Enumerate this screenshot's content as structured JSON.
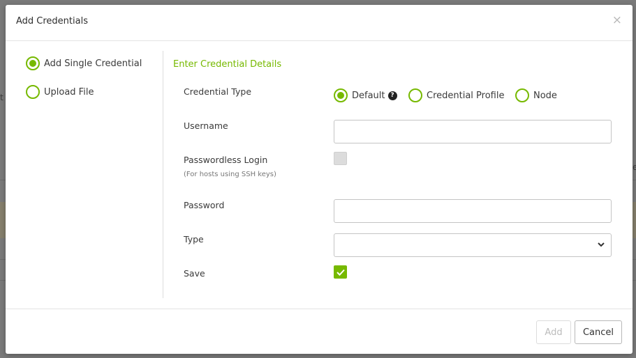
{
  "background": {
    "fragment_left": "t",
    "fragment_right": "e"
  },
  "modal": {
    "title": "Add Credentials",
    "close_icon": "close-icon"
  },
  "sidebar": {
    "items": [
      {
        "label": "Add Single Credential",
        "selected": true
      },
      {
        "label": "Upload File",
        "selected": false
      }
    ]
  },
  "form": {
    "section_title": "Enter Credential Details",
    "credential_type": {
      "label": "Credential Type",
      "options": [
        {
          "label": "Default",
          "selected": true,
          "has_info_icon": true
        },
        {
          "label": "Credential Profile",
          "selected": false
        },
        {
          "label": "Node",
          "selected": false
        }
      ],
      "info_icon": "question-circle-icon"
    },
    "username": {
      "label": "Username",
      "value": "",
      "placeholder": ""
    },
    "passwordless": {
      "label": "Passwordless Login",
      "sublabel": "(For hosts using SSH keys)",
      "checked": false
    },
    "password": {
      "label": "Password",
      "value": "",
      "placeholder": ""
    },
    "type": {
      "label": "Type",
      "value": ""
    },
    "save": {
      "label": "Save",
      "checked": true
    }
  },
  "footer": {
    "add_label": "Add",
    "cancel_label": "Cancel"
  },
  "colors": {
    "accent": "#76b900",
    "overlay": "#7a7a7a"
  }
}
